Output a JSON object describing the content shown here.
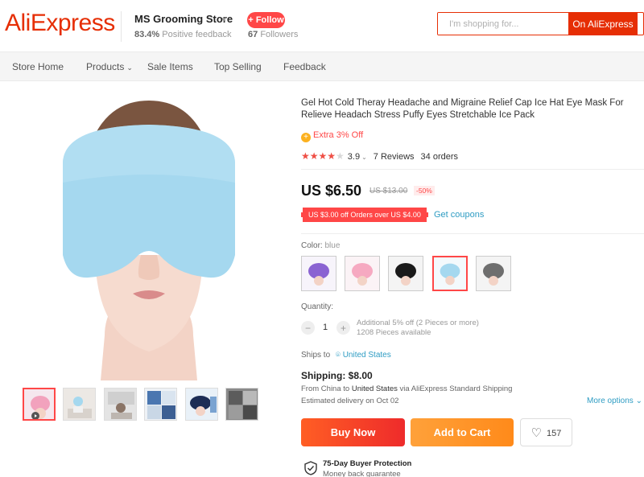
{
  "header": {
    "logo": "AliExpress",
    "store_name": "MS Grooming Store",
    "positive_feedback_pct": "83.4%",
    "positive_feedback_label": "Positive feedback",
    "follow_label": "+ Follow",
    "followers_count": "67",
    "followers_label": "Followers",
    "search_placeholder": "I'm shopping for...",
    "search_button": "On AliExpress"
  },
  "nav": {
    "items": [
      {
        "label": "Store Home"
      },
      {
        "label": "Products"
      },
      {
        "label": "Sale Items"
      },
      {
        "label": "Top Selling"
      },
      {
        "label": "Feedback"
      }
    ]
  },
  "product": {
    "title": "Gel Hot Cold Theray Headache and Migraine Relief Cap Ice Hat Eye Mask For Relieve Headach Stress Puffy Eyes Stretchable Ice Pack",
    "extra_off": "Extra 3% Off",
    "rating": "3.9",
    "rating_stars": 4,
    "reviews": "7 Reviews",
    "orders": "34 orders",
    "price": "US $6.50",
    "original_price": "US $13.00",
    "discount": "-50%",
    "coupon": "US $3.00 off Orders over US $4.00",
    "get_coupons": "Get coupons",
    "color_label": "Color:",
    "color_value": "blue",
    "colors": [
      {
        "name": "purple",
        "hex": "#8a63d2"
      },
      {
        "name": "pink",
        "hex": "#f6a9c1"
      },
      {
        "name": "black",
        "hex": "#1a1a1a"
      },
      {
        "name": "blue",
        "hex": "#a5d8ef"
      },
      {
        "name": "gray",
        "hex": "#6e6e6e"
      }
    ],
    "selected_color_index": 3,
    "quantity_label": "Quantity:",
    "quantity": "1",
    "qty_minus": "−",
    "qty_plus": "+",
    "additional_off": "Additional 5% off (2 Pieces or more)",
    "pieces_available": "1208 Pieces available",
    "ships_to_label": "Ships to",
    "ships_to_location": "United States",
    "shipping": "Shipping: $8.00",
    "ship_from": "From China to",
    "ship_to_country": "United States",
    "ship_via": "via AliExpress Standard Shipping",
    "estimated_delivery": "Estimated delivery on Oct 02",
    "more_options": "More options",
    "buy_now": "Buy Now",
    "add_to_cart": "Add to Cart",
    "wishlist_count": "157",
    "protection_title": "75-Day Buyer Protection",
    "protection_subtitle": "Money back guarantee"
  },
  "colors": {
    "brand": "#e62e04",
    "accent_red": "#ff4747",
    "link_blue": "#2e9cc3",
    "mask_blue": "#a5d8ef"
  }
}
